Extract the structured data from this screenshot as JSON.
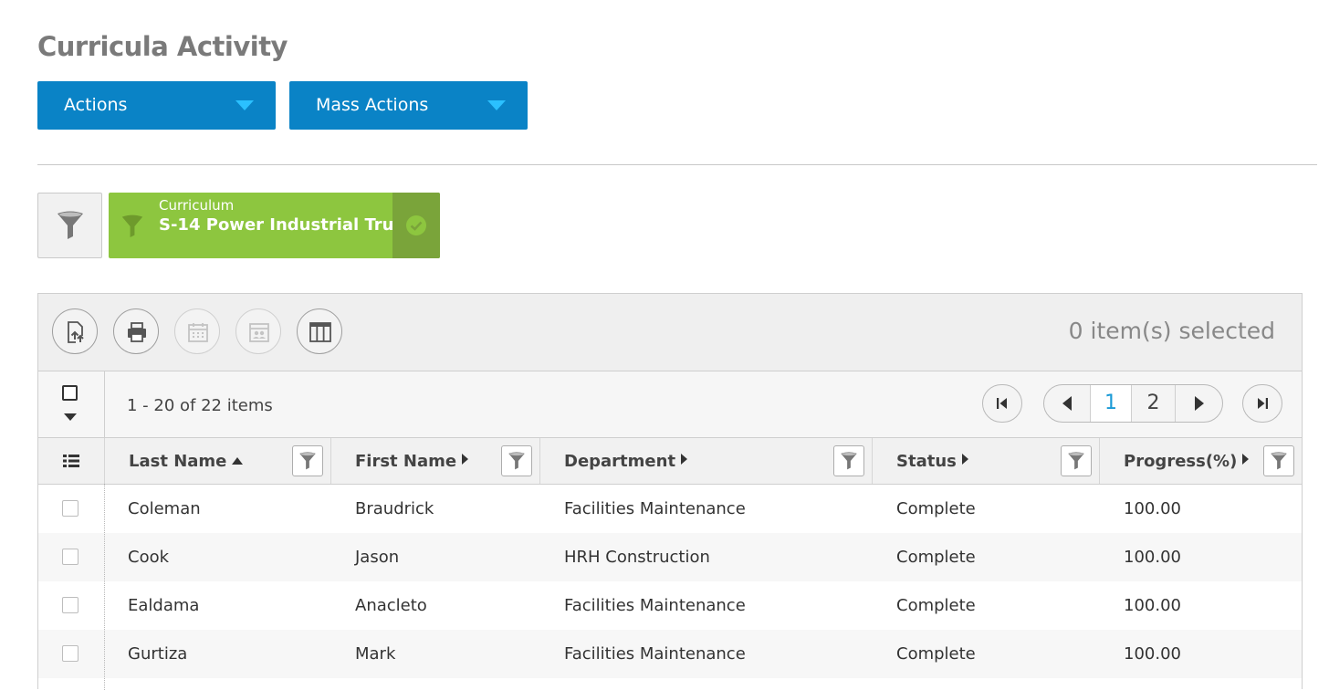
{
  "page": {
    "title": "Curricula Activity"
  },
  "buttons": {
    "actions": "Actions",
    "mass_actions": "Mass Actions"
  },
  "filter_chip": {
    "label": "Curriculum",
    "value": "S-14 Power Industrial Tru...",
    "color": "#8dc63f"
  },
  "toolbar": {
    "icons": [
      "export-icon",
      "print-icon",
      "calendar-icon",
      "roster-icon",
      "columns-icon"
    ],
    "selected_count": "0 item(s) selected"
  },
  "pager": {
    "range_text": "1 - 20 of 22 items",
    "pages": [
      "1",
      "2"
    ],
    "current_page": "1"
  },
  "table": {
    "columns": [
      "Last Name",
      "First Name",
      "Department",
      "Status",
      "Progress(%)"
    ],
    "sort": {
      "column": "Last Name",
      "direction": "ascending"
    },
    "rows": [
      {
        "last": "Coleman",
        "first": "Braudrick",
        "dept": "Facilities Maintenance",
        "status": "Complete",
        "progress": "100.00"
      },
      {
        "last": "Cook",
        "first": "Jason",
        "dept": "HRH Construction",
        "status": "Complete",
        "progress": "100.00"
      },
      {
        "last": "Ealdama",
        "first": "Anacleto",
        "dept": "Facilities Maintenance",
        "status": "Complete",
        "progress": "100.00"
      },
      {
        "last": "Gurtiza",
        "first": "Mark",
        "dept": "Facilities Maintenance",
        "status": "Complete",
        "progress": "100.00"
      }
    ]
  },
  "colors": {
    "primary": "#0a83c6",
    "caret": "#2bc0ff",
    "chip": "#8dc63f",
    "chip_check": "#7aa43a",
    "active_page": "#1a9ad6"
  }
}
